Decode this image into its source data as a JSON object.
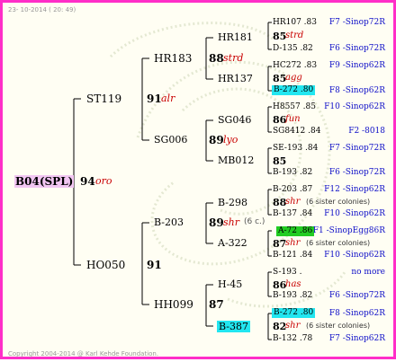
{
  "header": {
    "timestamp": "23- 10-2014 ( 20: 49)"
  },
  "footer": {
    "copyright": "Copyright 2004-2014 @ Karl Kehde Foundation."
  },
  "root": {
    "id": "B04(SPL)",
    "score": "94",
    "tag": "oro"
  },
  "gen1": {
    "upper": {
      "id": "ST119",
      "score": "91",
      "tag": "alr"
    },
    "lower": {
      "id": "HO050",
      "score": "91"
    }
  },
  "gen2": {
    "hr183": {
      "id": "HR183",
      "score": "88",
      "tag": "strd"
    },
    "sg006": {
      "id": "SG006",
      "score": "89",
      "tag": "lyo"
    },
    "b203": {
      "id": "B-203",
      "score": "89",
      "tag": "shr",
      "note": "(6 c.)"
    },
    "hh099": {
      "id": "HH099",
      "score": "87"
    }
  },
  "gen3": {
    "hr181": {
      "id": "HR181",
      "score": "85",
      "tag": "strd"
    },
    "hr137": {
      "id": "HR137",
      "score": "85",
      "tag": "agg"
    },
    "sg046": {
      "id": "SG046",
      "score": "86",
      "tag": "fun"
    },
    "mb012": {
      "id": "MB012",
      "score": "85"
    },
    "b298": {
      "id": "B-298",
      "score": "88",
      "tag": "shr",
      "note": "(6 sister colonies)"
    },
    "a322": {
      "id": "A-322",
      "score": "87",
      "tag": "shr",
      "note": "(6 sister colonies)"
    },
    "h45": {
      "id": "H-45",
      "score": "86",
      "tag": "has"
    },
    "b387": {
      "id": "B-387",
      "score": "82",
      "tag": "shr",
      "note": "(6 sister colonies)"
    }
  },
  "gen4": [
    {
      "name": "HR107 .83",
      "source": "F7 -Sinop72R"
    },
    {
      "name": "D-135 .82",
      "source": "F6 -Sinop72R"
    },
    {
      "name": "HC272 .83",
      "source": "F9 -Sinop62R"
    },
    {
      "name": "B-272 .80",
      "source": "F8 -Sinop62R"
    },
    {
      "name": "H8557 .85",
      "source": "F10 -Sinop62R"
    },
    {
      "name": "SG8412 .84",
      "source": "F2 -8018"
    },
    {
      "name": "SE-193 .84",
      "source": "F7 -Sinop72R"
    },
    {
      "name": "B-193 .82",
      "source": "F6 -Sinop72R"
    },
    {
      "name": "B-203 .87",
      "source": "F12 -Sinop62R"
    },
    {
      "name": "B-137 .84",
      "source": "F10 -Sinop62R"
    },
    {
      "name": "A-72 .86",
      "source": "F1 -SinopEgg86R"
    },
    {
      "name": "B-121 .84",
      "source": "F10 -Sinop62R"
    },
    {
      "name": "S-193 .",
      "source": "no more"
    },
    {
      "name": "B-193 .82",
      "source": "F6 -Sinop72R"
    },
    {
      "name": "B-272 .80",
      "source": "F8 -Sinop62R"
    },
    {
      "name": "B-132 .78",
      "source": "F7 -Sinop62R"
    }
  ],
  "colors": {
    "frame": "#ff2ec8",
    "root_highlight": "#f2c6f2",
    "cyan_highlight": "#22e6f0",
    "green_highlight": "#22cc22",
    "source_text": "#1010c8",
    "tag_text": "#c80000"
  }
}
